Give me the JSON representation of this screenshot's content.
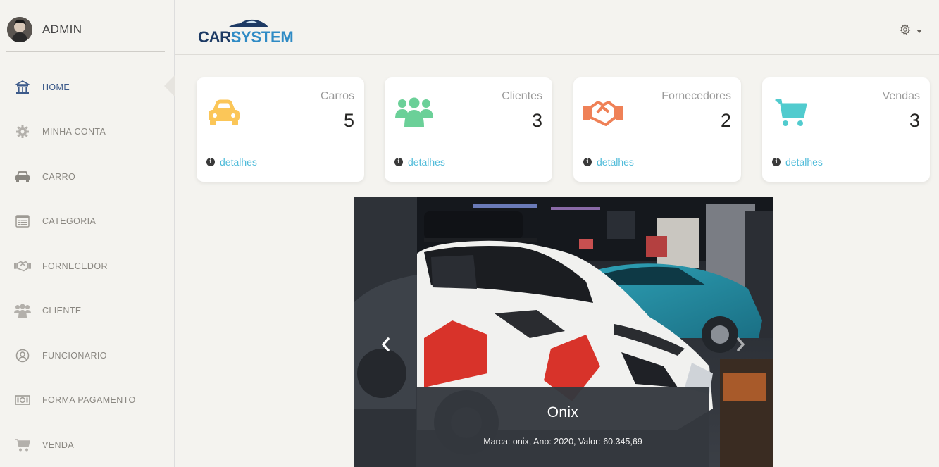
{
  "user": {
    "name": "ADMIN"
  },
  "sidebar": {
    "items": [
      {
        "label": "HOME",
        "icon": "bank-icon",
        "active": true
      },
      {
        "label": "MINHA CONTA",
        "icon": "gear-icon"
      },
      {
        "label": "CARRO",
        "icon": "car-icon"
      },
      {
        "label": "CATEGORIA",
        "icon": "list-icon"
      },
      {
        "label": "FORNECEDOR",
        "icon": "handshake-icon"
      },
      {
        "label": "CLIENTE",
        "icon": "users-icon"
      },
      {
        "label": "FUNCIONARIO",
        "icon": "user-circle-icon"
      },
      {
        "label": "FORMA PAGAMENTO",
        "icon": "money-icon"
      },
      {
        "label": "VENDA",
        "icon": "cart-icon"
      }
    ]
  },
  "header": {
    "logo_part1": "CAR",
    "logo_part2": "SYSTEM",
    "settings_icon": "gear-icon"
  },
  "cards": [
    {
      "title": "Carros",
      "value": "5",
      "link": "detalhes",
      "icon": "car-icon",
      "color": "#fbc658"
    },
    {
      "title": "Clientes",
      "value": "3",
      "link": "detalhes",
      "icon": "users-icon",
      "color": "#6bd098"
    },
    {
      "title": "Fornecedores",
      "value": "2",
      "link": "detalhes",
      "icon": "handshake-icon",
      "color": "#ef8157"
    },
    {
      "title": "Vendas",
      "value": "3",
      "link": "detalhes",
      "icon": "cart-icon",
      "color": "#51cbce"
    }
  ],
  "carousel": {
    "title": "Onix",
    "description": "Marca: onix, Ano: 2020, Valor: 60.345,69",
    "prev_icon": "chevron-left-icon",
    "next_icon": "chevron-right-icon"
  },
  "colors": {
    "link": "#51bcda",
    "background": "#f4f3ef"
  }
}
